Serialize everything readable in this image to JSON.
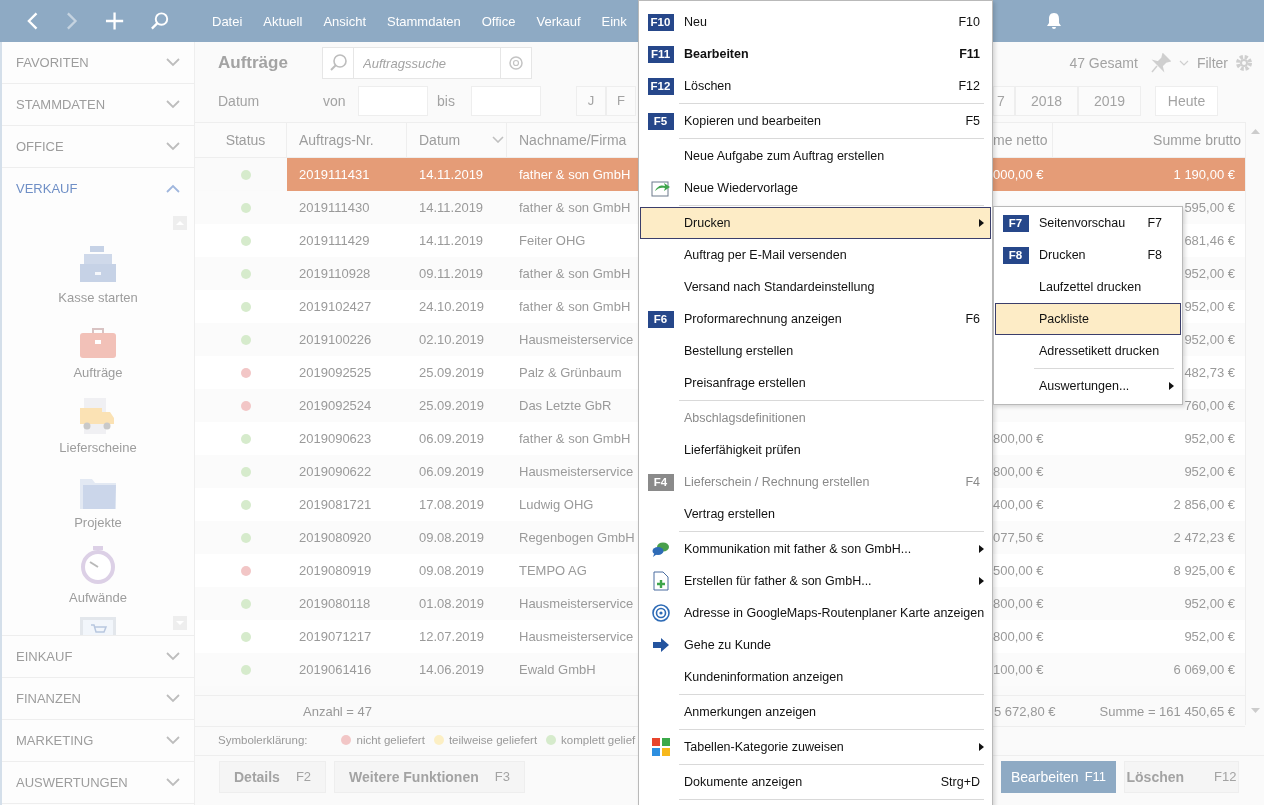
{
  "menubar": {
    "items": [
      "Datei",
      "Aktuell",
      "Ansicht",
      "Stammdaten",
      "Office",
      "Verkauf",
      "Eink"
    ]
  },
  "sidebar": {
    "sections": [
      {
        "label": "FAVORITEN",
        "expanded": false
      },
      {
        "label": "STAMMDATEN",
        "expanded": false
      },
      {
        "label": "OFFICE",
        "expanded": false
      },
      {
        "label": "VERKAUF",
        "expanded": true,
        "items": [
          "Kasse starten",
          "Aufträge",
          "Lieferscheine",
          "Projekte",
          "Aufwände"
        ]
      },
      {
        "label": "EINKAUF",
        "expanded": false
      },
      {
        "label": "FINANZEN",
        "expanded": false
      },
      {
        "label": "MARKETING",
        "expanded": false
      },
      {
        "label": "AUSWERTUNGEN",
        "expanded": false
      }
    ]
  },
  "toolbar": {
    "title": "Aufträge",
    "search": {
      "placeholder": "Auftragssuche"
    },
    "total": "47 Gesamt",
    "filter": "Filter"
  },
  "date_filter": {
    "label": "Datum",
    "from": "von",
    "to": "bis",
    "months": [
      "J",
      "F"
    ],
    "years": [
      "7",
      "2018",
      "2019"
    ],
    "today": "Heute"
  },
  "table": {
    "columns": [
      "Status",
      "Auftrags-Nr.",
      "Datum",
      "Nachname/Firma",
      "me netto",
      "Summe brutto"
    ],
    "rows": [
      {
        "nr": "2019111431",
        "date": "14.11.2019",
        "name": "father & son GmbH",
        "netto": "000,00 €",
        "brutto": "1 190,00 €",
        "color": "#d6ebcc",
        "selected": true
      },
      {
        "nr": "2019111430",
        "date": "14.11.2019",
        "name": "father & son GmbH",
        "brutto": "595,00 €",
        "color": "#d6ebcc",
        "selected": false
      },
      {
        "nr": "2019111429",
        "date": "14.11.2019",
        "name": "Feiter OHG",
        "brutto": "681,46 €",
        "color": "#d6ebcc",
        "selected": false
      },
      {
        "nr": "2019110928",
        "date": "09.11.2019",
        "name": "father & son GmbH",
        "brutto": "952,00 €",
        "color": "#d6ebcc",
        "selected": false
      },
      {
        "nr": "2019102427",
        "date": "24.10.2019",
        "name": "father & son GmbH",
        "brutto": "952,00 €",
        "color": "#d6ebcc",
        "selected": false
      },
      {
        "nr": "2019100226",
        "date": "02.10.2019",
        "name": "Hausmeisterservice",
        "brutto": "952,00 €",
        "color": "#d6ebcc",
        "selected": false
      },
      {
        "nr": "2019092525",
        "date": "25.09.2019",
        "name": "Palz & Grünbaum",
        "brutto": "482,73 €",
        "color": "#f2c6c6",
        "selected": false
      },
      {
        "nr": "2019092524",
        "date": "25.09.2019",
        "name": "Das Letzte GbR",
        "brutto": "760,00 €",
        "color": "#f2c6c6",
        "selected": false
      },
      {
        "nr": "2019090623",
        "date": "06.09.2019",
        "name": "father & son GmbH",
        "netto": "800,00 €",
        "brutto": "952,00 €",
        "color": "#d6ebcc",
        "selected": false
      },
      {
        "nr": "2019090622",
        "date": "06.09.2019",
        "name": "Hausmeisterservice",
        "netto": "800,00 €",
        "brutto": "952,00 €",
        "color": "#d6ebcc",
        "selected": false
      },
      {
        "nr": "2019081721",
        "date": "17.08.2019",
        "name": "Ludwig OHG",
        "netto": "400,00 €",
        "brutto": "2 856,00 €",
        "color": "#d6ebcc",
        "selected": false
      },
      {
        "nr": "2019080920",
        "date": "09.08.2019",
        "name": "Regenbogen GmbH",
        "netto": "077,50 €",
        "brutto": "2 472,23 €",
        "color": "#d6ebcc",
        "selected": false
      },
      {
        "nr": "2019080919",
        "date": "09.08.2019",
        "name": "TEMPO AG",
        "netto": "500,00 €",
        "brutto": "8 925,00 €",
        "color": "#f2c6c6",
        "selected": false
      },
      {
        "nr": "2019080118",
        "date": "01.08.2019",
        "name": "Hausmeisterservice",
        "netto": "800,00 €",
        "brutto": "952,00 €",
        "color": "#d6ebcc",
        "selected": false
      },
      {
        "nr": "2019071217",
        "date": "12.07.2019",
        "name": "Hausmeisterservice",
        "netto": "800,00 €",
        "brutto": "952,00 €",
        "color": "#d6ebcc",
        "selected": false
      },
      {
        "nr": "2019061416",
        "date": "14.06.2019",
        "name": "Ewald GmbH",
        "netto": "100,00 €",
        "brutto": "6 069,00 €",
        "color": "#d6ebcc",
        "selected": false
      }
    ],
    "summary": {
      "count": "Anzahl = 47",
      "netto": "5 672,80 €",
      "brutto": "Summe = 161 450,65 €"
    }
  },
  "legend": {
    "label": "Symbolerklärung:",
    "items": [
      {
        "label": "nicht geliefert",
        "color": "#f2c6c6"
      },
      {
        "label": "teilweise geliefert",
        "color": "#fcefc4"
      },
      {
        "label": "komplett gelief",
        "color": "#d6ebcc"
      }
    ]
  },
  "buttons_left": [
    {
      "label": "Details",
      "key": "F2",
      "primary": false
    },
    {
      "label": "Weitere Funktionen",
      "key": "F3",
      "primary": false
    }
  ],
  "buttons_right": [
    {
      "label": "Bearbeiten",
      "key": "F11",
      "primary": true
    },
    {
      "label": "Löschen",
      "key": "F12",
      "primary": false
    }
  ],
  "context_menu": {
    "items": [
      {
        "kind": "item",
        "badge": "F10",
        "label": "Neu",
        "shortcut": "F10",
        "bold": false,
        "disabled": false,
        "has_submenu": false,
        "selected": false
      },
      {
        "kind": "item",
        "badge": "F11",
        "label": "Bearbeiten",
        "shortcut": "F11",
        "bold": true,
        "disabled": false,
        "has_submenu": false,
        "selected": false
      },
      {
        "kind": "item",
        "badge": "F12",
        "label": "Löschen",
        "shortcut": "F12",
        "bold": false,
        "disabled": false,
        "has_submenu": false,
        "selected": false
      },
      {
        "kind": "separator"
      },
      {
        "kind": "item",
        "badge": "F5",
        "label": "Kopieren und bearbeiten",
        "shortcut": "F5",
        "bold": false,
        "disabled": false,
        "has_submenu": false,
        "selected": false
      },
      {
        "kind": "separator"
      },
      {
        "kind": "item",
        "label": "Neue Aufgabe zum Auftrag erstellen",
        "bold": false,
        "disabled": false,
        "has_submenu": false,
        "selected": false
      },
      {
        "kind": "item",
        "label": "Neue Wiedervorlage",
        "bold": false,
        "disabled": false,
        "has_submenu": false,
        "selected": false
      },
      {
        "kind": "separator"
      },
      {
        "kind": "item",
        "label": "Drucken",
        "bold": false,
        "disabled": false,
        "has_submenu": true,
        "selected": true
      },
      {
        "kind": "item",
        "label": "Auftrag per E-Mail versenden",
        "bold": false,
        "disabled": false,
        "has_submenu": false,
        "selected": false
      },
      {
        "kind": "item",
        "label": "Versand nach Standardeinstellung",
        "bold": false,
        "disabled": false,
        "has_submenu": false,
        "selected": false
      },
      {
        "kind": "item",
        "badge": "F6",
        "label": "Proformarechnung anzeigen",
        "shortcut": "F6",
        "bold": false,
        "disabled": false,
        "has_submenu": false,
        "selected": false
      },
      {
        "kind": "item",
        "label": "Bestellung erstellen",
        "bold": false,
        "disabled": false,
        "has_submenu": false,
        "selected": false
      },
      {
        "kind": "item",
        "label": "Preisanfrage erstellen",
        "bold": false,
        "disabled": false,
        "has_submenu": false,
        "selected": false
      },
      {
        "kind": "separator"
      },
      {
        "kind": "item",
        "label": "Abschlagsdefinitionen",
        "bold": false,
        "disabled": true,
        "has_submenu": false,
        "selected": false
      },
      {
        "kind": "item",
        "label": "Lieferfähigkeit prüfen",
        "bold": false,
        "disabled": false,
        "has_submenu": false,
        "selected": false
      },
      {
        "kind": "item",
        "badge": "F4",
        "label": "Lieferschein / Rechnung erstellen",
        "shortcut": "F4",
        "bold": false,
        "disabled": true,
        "has_submenu": false,
        "selected": false
      },
      {
        "kind": "item",
        "label": "Vertrag erstellen",
        "bold": false,
        "disabled": false,
        "has_submenu": false,
        "selected": false
      },
      {
        "kind": "separator"
      },
      {
        "kind": "item",
        "label": "Kommunikation mit father & son GmbH...",
        "bold": false,
        "disabled": false,
        "has_submenu": true,
        "selected": false
      },
      {
        "kind": "item",
        "label": "Erstellen für father & son GmbH...",
        "bold": false,
        "disabled": false,
        "has_submenu": true,
        "selected": false
      },
      {
        "kind": "item",
        "label": "Adresse in GoogleMaps-Routenplaner Karte anzeigen",
        "bold": false,
        "disabled": false,
        "has_submenu": false,
        "selected": false
      },
      {
        "kind": "item",
        "label": "Gehe zu Kunde",
        "bold": false,
        "disabled": false,
        "has_submenu": false,
        "selected": false
      },
      {
        "kind": "item",
        "label": "Kundeninformation anzeigen",
        "bold": false,
        "disabled": false,
        "has_submenu": false,
        "selected": false
      },
      {
        "kind": "separator"
      },
      {
        "kind": "item",
        "label": "Anmerkungen anzeigen",
        "bold": false,
        "disabled": false,
        "has_submenu": false,
        "selected": false
      },
      {
        "kind": "separator"
      },
      {
        "kind": "item",
        "label": "Tabellen-Kategorie zuweisen",
        "bold": false,
        "disabled": false,
        "has_submenu": true,
        "selected": false
      },
      {
        "kind": "separator"
      },
      {
        "kind": "item",
        "label": "Dokumente anzeigen",
        "shortcut": "Strg+D",
        "bold": false,
        "disabled": false,
        "has_submenu": false,
        "selected": false
      },
      {
        "kind": "separator"
      }
    ]
  },
  "submenu": {
    "items": [
      {
        "kind": "item",
        "badge": "F7",
        "label": "Seitenvorschau",
        "shortcut": "F7",
        "bold": false,
        "disabled": false,
        "has_submenu": false,
        "selected": false
      },
      {
        "kind": "item",
        "badge": "F8",
        "label": "Drucken",
        "shortcut": "F8",
        "bold": false,
        "disabled": false,
        "has_submenu": false,
        "selected": false
      },
      {
        "kind": "item",
        "label": "Laufzettel drucken",
        "bold": false,
        "disabled": false,
        "has_submenu": false,
        "selected": false
      },
      {
        "kind": "item",
        "label": "Packliste",
        "bold": false,
        "disabled": false,
        "has_submenu": false,
        "selected": true
      },
      {
        "kind": "item",
        "label": "Adressetikett drucken",
        "bold": false,
        "disabled": false,
        "has_submenu": false,
        "selected": false
      },
      {
        "kind": "separator"
      },
      {
        "kind": "item",
        "label": "Auswertungen...",
        "bold": false,
        "disabled": false,
        "has_submenu": true,
        "selected": false
      }
    ]
  }
}
